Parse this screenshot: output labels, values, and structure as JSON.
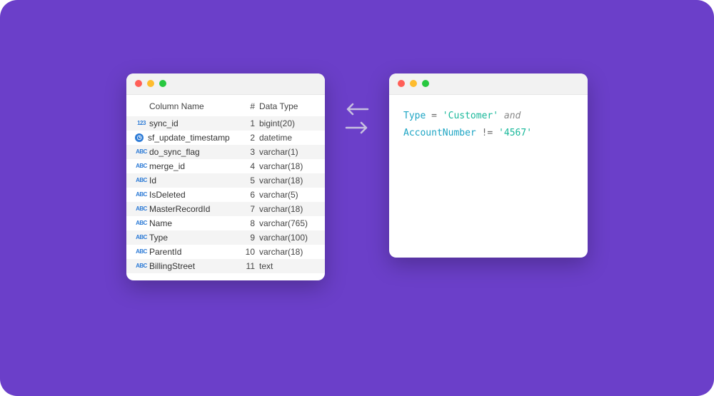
{
  "table": {
    "headers": {
      "name": "Column Name",
      "num": "#",
      "type": "Data Type"
    },
    "rows": [
      {
        "icon": "123",
        "name": "sync_id",
        "num": "1",
        "type": "bigint(20)"
      },
      {
        "icon": "clock",
        "name": "sf_update_timestamp",
        "num": "2",
        "type": "datetime"
      },
      {
        "icon": "ABC",
        "name": "do_sync_flag",
        "num": "3",
        "type": "varchar(1)"
      },
      {
        "icon": "ABC",
        "name": "merge_id",
        "num": "4",
        "type": "varchar(18)"
      },
      {
        "icon": "ABC",
        "name": "Id",
        "num": "5",
        "type": "varchar(18)"
      },
      {
        "icon": "ABC",
        "name": "IsDeleted",
        "num": "6",
        "type": "varchar(5)"
      },
      {
        "icon": "ABC",
        "name": "MasterRecordId",
        "num": "7",
        "type": "varchar(18)"
      },
      {
        "icon": "ABC",
        "name": "Name",
        "num": "8",
        "type": "varchar(765)"
      },
      {
        "icon": "ABC",
        "name": "Type",
        "num": "9",
        "type": "varchar(100)"
      },
      {
        "icon": "ABC",
        "name": "ParentId",
        "num": "10",
        "type": "varchar(18)"
      },
      {
        "icon": "ABC",
        "name": "BillingStreet",
        "num": "11",
        "type": "text"
      }
    ]
  },
  "code": {
    "line1": {
      "field": "Type",
      "op": "=",
      "str": "'Customer'",
      "kw": "and"
    },
    "line2": {
      "field": "AccountNumber",
      "op": "!=",
      "str": "'4567'"
    }
  }
}
